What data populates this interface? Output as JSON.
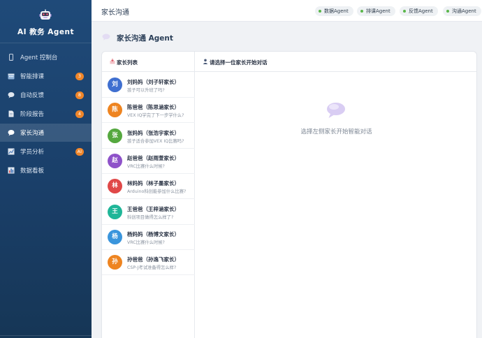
{
  "app": {
    "title": "AI 教务 Agent"
  },
  "sidebar": {
    "items": [
      {
        "label": "Agent 控制台",
        "icon": "phone-icon",
        "badge": ""
      },
      {
        "label": "智能排课",
        "icon": "calendar-icon",
        "badge": "3"
      },
      {
        "label": "自动反馈",
        "icon": "speech-bubble-icon",
        "badge": "8"
      },
      {
        "label": "阶段报告",
        "icon": "document-icon",
        "badge": "4"
      },
      {
        "label": "家长沟通",
        "icon": "chat-bubble-icon",
        "badge": ""
      },
      {
        "label": "学员分析",
        "icon": "trend-chart-icon",
        "badge": "AI"
      },
      {
        "label": "数据看板",
        "icon": "bar-chart-icon",
        "badge": ""
      }
    ]
  },
  "topbar": {
    "title": "家长沟通",
    "agents": [
      "数据Agent",
      "排课Agent",
      "反馈Agent",
      "沟通Agent"
    ]
  },
  "page": {
    "title": "家长沟通 Agent"
  },
  "parents_panel": {
    "title": "家长列表",
    "list": [
      {
        "initial": "刘",
        "name": "刘妈妈（刘子轩家长）",
        "msg": "孩子可以升班了吗?",
        "color": "#3f6fd0"
      },
      {
        "initial": "陈",
        "name": "陈爸爸（陈思涵家长）",
        "msg": "VEX IQ学完了下一步学什么?",
        "color": "#ee8420"
      },
      {
        "initial": "张",
        "name": "张妈妈（张浩宇家长）",
        "msg": "孩子适合参加VEX IQ比赛吗?",
        "color": "#55a83f"
      },
      {
        "initial": "赵",
        "name": "赵爸爸（赵雨萱家长）",
        "msg": "VRC比赛什么时候?",
        "color": "#8e52c9"
      },
      {
        "initial": "林",
        "name": "林妈妈（林子墨家长）",
        "msg": "Arduino科创能参加什么比赛?",
        "color": "#e04848"
      },
      {
        "initial": "王",
        "name": "王爸爸（王梓涵家长）",
        "msg": "科创项目做得怎么样了?",
        "color": "#1fb698"
      },
      {
        "initial": "杨",
        "name": "杨妈妈（杨博文家长）",
        "msg": "VRC比赛什么时候?",
        "color": "#3a95dc"
      },
      {
        "initial": "孙",
        "name": "孙爸爸（孙逸飞家长）",
        "msg": "CSP-J考试准备得怎么样?",
        "color": "#ee8420"
      }
    ]
  },
  "chat_panel": {
    "title": "请选择一位家长开始对话",
    "empty_text": "选择左侧家长开始智能对话"
  },
  "colors": {
    "sidebar": "#1f4a79",
    "badge": "#f0862a",
    "online": "#5ab64a",
    "accent": "#8e6fd6"
  }
}
